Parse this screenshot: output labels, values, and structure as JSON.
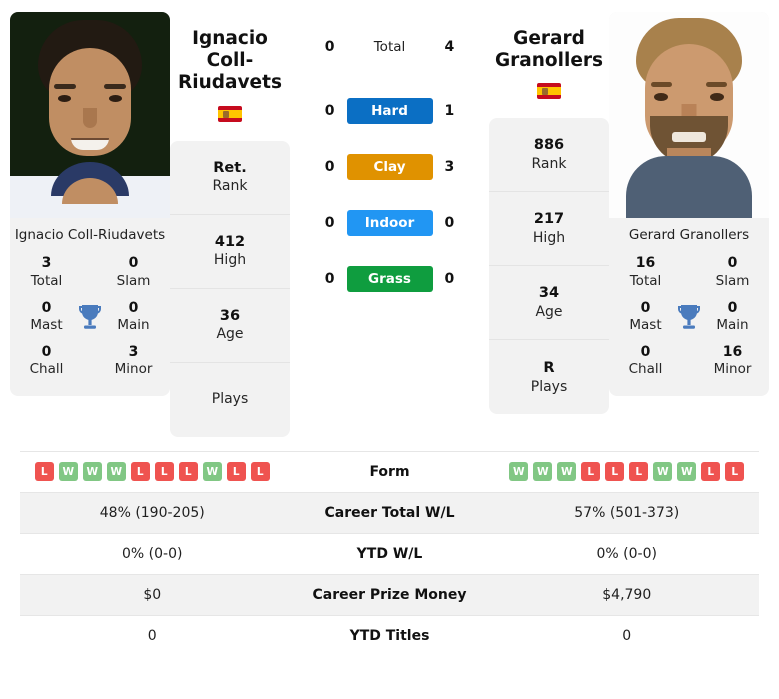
{
  "players": {
    "left": {
      "name": "Ignacio Coll-Riudavets",
      "display_name_line1": "Ignacio Coll-",
      "display_name_line2": "Riudavets",
      "country_flag": "spain-flag",
      "photo_caption": "Ignacio Coll-Riudavets",
      "titles": {
        "total_value": "3",
        "total_label": "Total",
        "slam_value": "0",
        "slam_label": "Slam",
        "mast_value": "0",
        "mast_label": "Mast",
        "main_value": "0",
        "main_label": "Main",
        "chall_value": "0",
        "chall_label": "Chall",
        "minor_value": "3",
        "minor_label": "Minor"
      },
      "info": [
        {
          "value": "Ret.",
          "label": "Rank"
        },
        {
          "value": "412",
          "label": "High"
        },
        {
          "value": "36",
          "label": "Age"
        },
        {
          "value": "",
          "label": "Plays"
        }
      ],
      "surface_values": {
        "total": "0",
        "hard": "0",
        "clay": "0",
        "indoor": "0",
        "grass": "0"
      },
      "form": [
        "L",
        "W",
        "W",
        "W",
        "L",
        "L",
        "L",
        "W",
        "L",
        "L"
      ],
      "career_total_wl": "48% (190-205)",
      "ytd_wl": "0% (0-0)",
      "career_prize_money": "$0",
      "ytd_titles": "0"
    },
    "right": {
      "name": "Gerard Granollers",
      "display_name_line1": "Gerard",
      "display_name_line2": "Granollers",
      "country_flag": "spain-flag",
      "photo_caption": "Gerard Granollers",
      "titles": {
        "total_value": "16",
        "total_label": "Total",
        "slam_value": "0",
        "slam_label": "Slam",
        "mast_value": "0",
        "mast_label": "Mast",
        "main_value": "0",
        "main_label": "Main",
        "chall_value": "0",
        "chall_label": "Chall",
        "minor_value": "16",
        "minor_label": "Minor"
      },
      "info": [
        {
          "value": "886",
          "label": "Rank"
        },
        {
          "value": "217",
          "label": "High"
        },
        {
          "value": "34",
          "label": "Age"
        },
        {
          "value": "R",
          "label": "Plays"
        }
      ],
      "surface_values": {
        "total": "4",
        "hard": "1",
        "clay": "3",
        "indoor": "0",
        "grass": "0"
      },
      "form": [
        "W",
        "W",
        "W",
        "L",
        "L",
        "L",
        "W",
        "W",
        "L",
        "L"
      ],
      "career_total_wl": "57% (501-373)",
      "ytd_wl": "0% (0-0)",
      "career_prize_money": "$4,790",
      "ytd_titles": "0"
    }
  },
  "surfaces": [
    {
      "key": "total",
      "label": "Total",
      "color": ""
    },
    {
      "key": "hard",
      "label": "Hard",
      "color": "#0b6fc4"
    },
    {
      "key": "clay",
      "label": "Clay",
      "color": "#e09200"
    },
    {
      "key": "indoor",
      "label": "Indoor",
      "color": "#2196f3"
    },
    {
      "key": "grass",
      "label": "Grass",
      "color": "#0f9d3f"
    }
  ],
  "table_rows": [
    {
      "label": "Form"
    },
    {
      "label": "Career Total W/L"
    },
    {
      "label": "YTD W/L"
    },
    {
      "label": "Career Prize Money"
    },
    {
      "label": "YTD Titles"
    }
  ],
  "colors": {
    "win_badge": "#81c784",
    "loss_badge": "#ef5350",
    "card_bg": "#f2f2f2",
    "trophy": "#4a7bbd"
  }
}
